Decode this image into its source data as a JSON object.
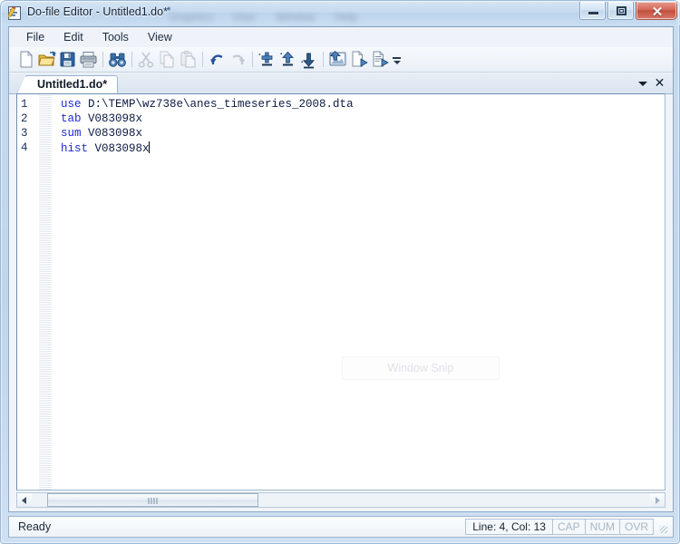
{
  "window": {
    "title": "Do-file Editor - Untitled1.do*",
    "icon": "document-pencil-icon",
    "ghost_menu_items": [
      "Graphics",
      "User",
      "Window",
      "Help"
    ],
    "ghost_marker": "*",
    "controls": {
      "minimize_label": "",
      "restore_label": "",
      "close_label": "✕"
    }
  },
  "menubar": {
    "items": [
      {
        "label": "File",
        "name": "menu-file"
      },
      {
        "label": "Edit",
        "name": "menu-edit"
      },
      {
        "label": "Tools",
        "name": "menu-tools"
      },
      {
        "label": "View",
        "name": "menu-view"
      }
    ]
  },
  "toolbar": {
    "buttons": [
      {
        "name": "new-do-file-icon",
        "enabled": true
      },
      {
        "name": "open-folder-icon",
        "enabled": true
      },
      {
        "name": "save-icon",
        "enabled": true
      },
      {
        "name": "print-icon",
        "enabled": true
      },
      {
        "name": "find-binoculars-icon",
        "enabled": true
      },
      {
        "name": "cut-scissors-icon",
        "enabled": false
      },
      {
        "name": "copy-icon",
        "enabled": false
      },
      {
        "name": "paste-icon",
        "enabled": false
      },
      {
        "name": "undo-icon",
        "enabled": true
      },
      {
        "name": "redo-icon",
        "enabled": false
      },
      {
        "name": "insert-breakpoint-icon",
        "enabled": true
      },
      {
        "name": "run-to-cursor-icon",
        "enabled": true
      },
      {
        "name": "step-icon",
        "enabled": true
      },
      {
        "name": "preview-icon",
        "enabled": true
      },
      {
        "name": "do-file-icon",
        "enabled": true
      },
      {
        "name": "run-file-icon",
        "enabled": true
      }
    ],
    "overflow_label": "toolbar-overflow"
  },
  "tabstrip": {
    "active_tab": "Untitled1.do*",
    "dropdown_label": "",
    "close_label": "✕"
  },
  "editor": {
    "lines": [
      {
        "number": "1",
        "keyword": "use",
        "argument": " D:\\TEMP\\wz738e\\anes_timeseries_2008.dta"
      },
      {
        "number": "2",
        "keyword": "tab",
        "argument": " V083098x"
      },
      {
        "number": "3",
        "keyword": "sum",
        "argument": " V083098x"
      },
      {
        "number": "4",
        "keyword": "hist",
        "argument": " V083098x"
      }
    ],
    "caret_line": 4,
    "colors": {
      "keyword": "#1c2bd1",
      "argument": "#0d1b44",
      "line_number": "#1c2d5e",
      "background": "#ffffff"
    }
  },
  "overlay": {
    "snip_label": "Window Snip"
  },
  "scrollbar": {
    "left_arrow": "◀",
    "right_arrow": "▶"
  },
  "statusbar": {
    "message": "Ready",
    "line_col": "Line: 4, Col: 13",
    "indicators": [
      {
        "label": "CAP",
        "name": "status-cap",
        "active": false
      },
      {
        "label": "NUM",
        "name": "status-num",
        "active": false
      },
      {
        "label": "OVR",
        "name": "status-ovr",
        "active": false
      }
    ]
  }
}
